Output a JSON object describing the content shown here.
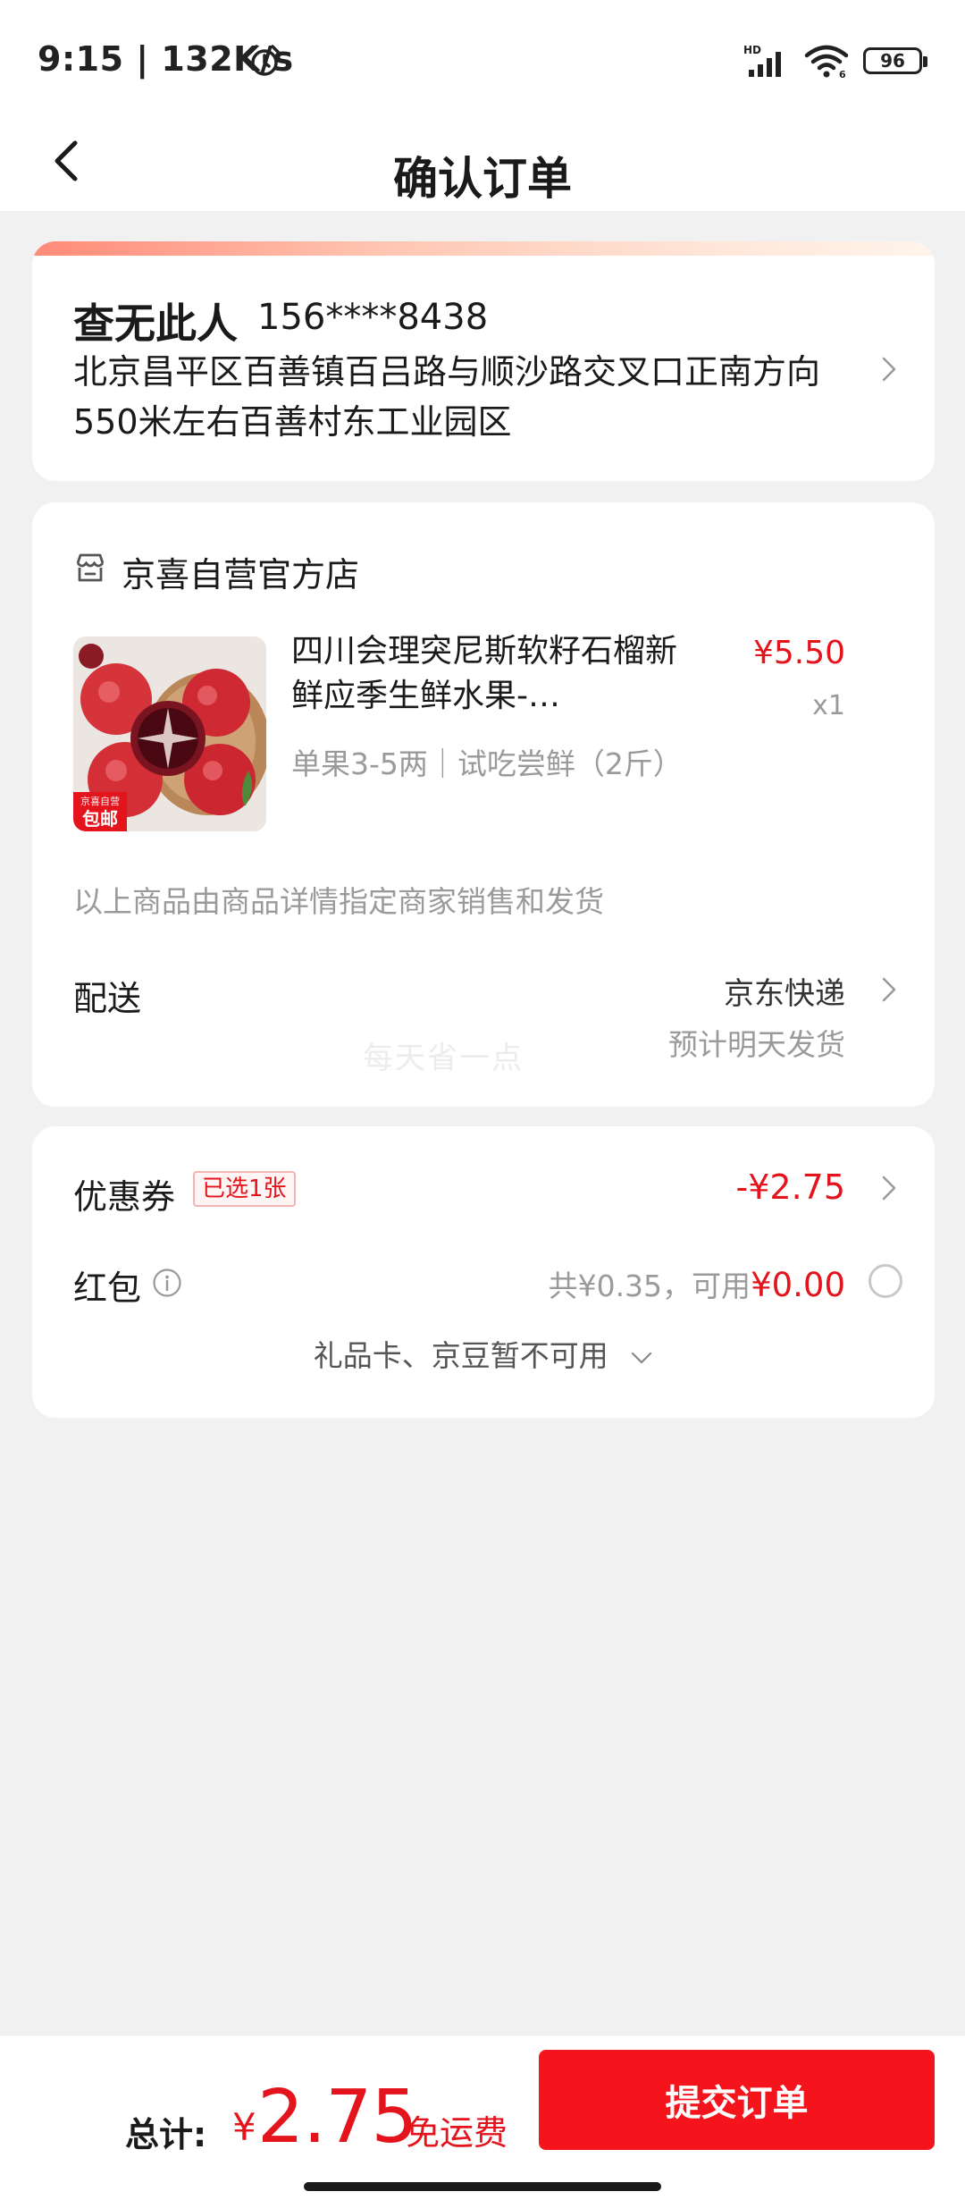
{
  "status_bar": {
    "time": "9:15 | 132K/s",
    "battery": "96",
    "signal_label": "HD",
    "wifi_label": "6"
  },
  "header": {
    "title": "确认订单"
  },
  "address": {
    "name": "查无此人",
    "phone": "156****8438",
    "detail": "北京昌平区百善镇百吕路与顺沙路交叉口正南方向550米左右百善村东工业园区"
  },
  "order": {
    "store_name": "京喜自营官方店",
    "product": {
      "title": "四川会理突尼斯软籽石榴新鲜应季生鲜水果-…",
      "spec": "单果3-5两｜试吃尝鲜（2斤）",
      "price": "¥5.50",
      "quantity": "x1",
      "badge_top": "京喜自营",
      "badge_main": "包邮"
    },
    "seller_note": "以上商品由商品详情指定商家销售和发货",
    "delivery": {
      "label": "配送",
      "method": "京东快递",
      "eta": "预计明天发货"
    },
    "watermark": "每天省一点"
  },
  "discounts": {
    "coupon_label": "优惠券",
    "coupon_tag": "已选1张",
    "coupon_amount": "-¥2.75",
    "redpacket_label": "红包",
    "redpacket_total": "共¥0.35，可用",
    "redpacket_available": "¥0.00",
    "giftcard_text": "礼品卡、京豆暂不可用"
  },
  "footer": {
    "total_label": "总计:",
    "currency": "¥",
    "total_amount": "2.75",
    "free_shipping": "免运费",
    "submit_label": "提交订单"
  },
  "colors": {
    "accent_red": "#e3141c",
    "button_red": "#f5141c",
    "background": "#f1f1f1"
  },
  "icons": [
    "alarm-icon",
    "signal-icon",
    "wifi-icon",
    "battery-icon",
    "back-icon",
    "chevron-right-icon",
    "store-icon",
    "info-icon",
    "chevron-down-icon"
  ]
}
